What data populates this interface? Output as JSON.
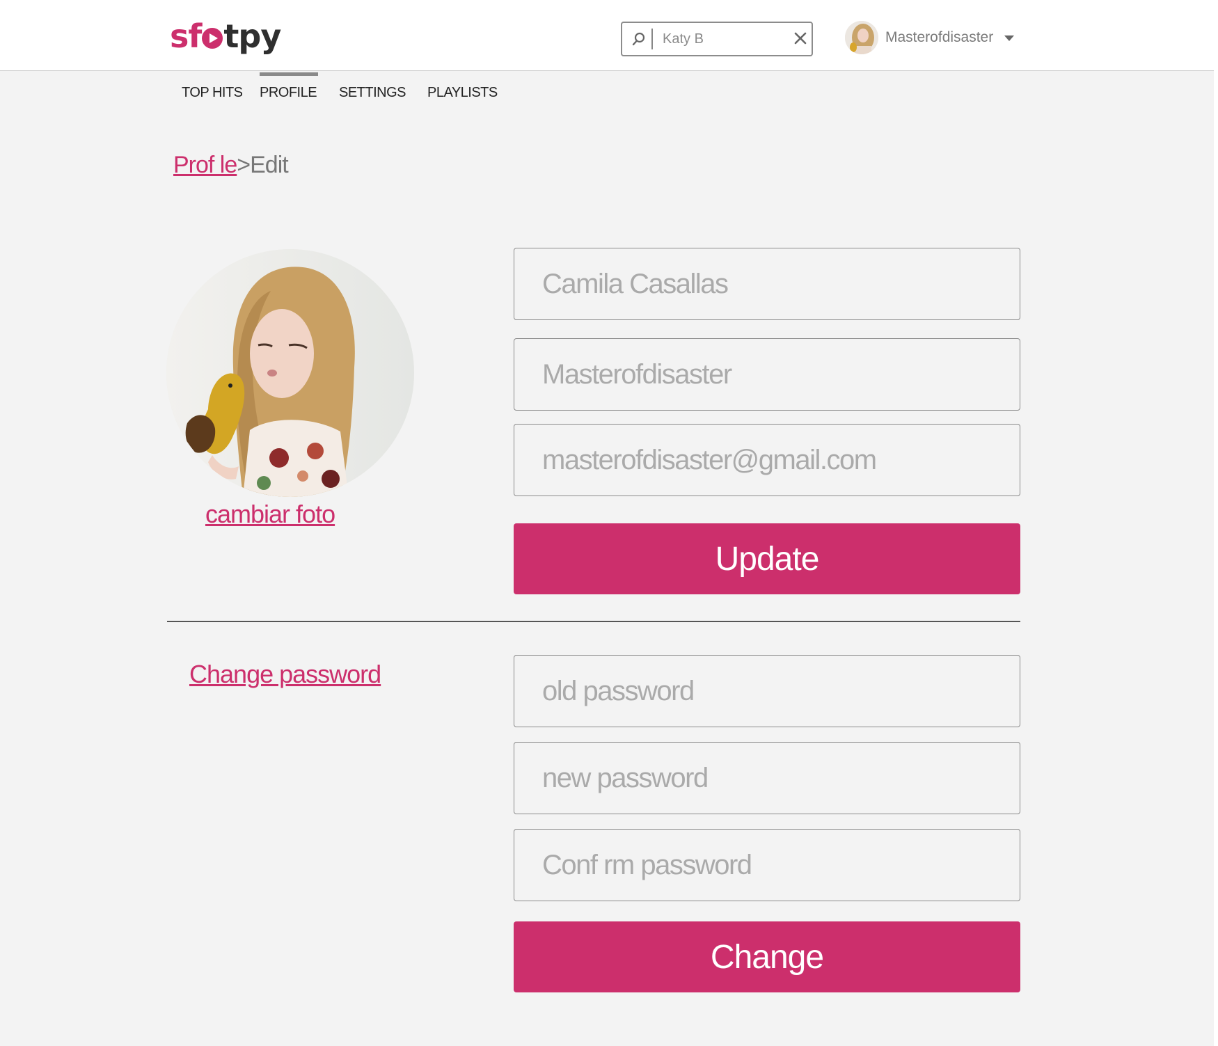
{
  "app": {
    "logo_parts": [
      "sf",
      "t",
      "py"
    ],
    "brand_color": "#cc2f6c"
  },
  "search": {
    "value": "Katy B",
    "icon": "search-icon",
    "clear_icon": "close-icon"
  },
  "user": {
    "name": "Masterofdisaster",
    "menu_icon": "caret-down-icon"
  },
  "tabs": [
    {
      "label": "TOP HITS"
    },
    {
      "label": "PROFILE",
      "active": true
    },
    {
      "label": "SETTINGS"
    },
    {
      "label": "PLAYLISTS"
    }
  ],
  "breadcrumb": {
    "parent": "Prof le",
    "separator": ">",
    "current": "Edit"
  },
  "profile": {
    "change_photo_label": "cambiar foto",
    "full_name": "Camila Casallas",
    "username": "Masterofdisaster",
    "email": "masterofdisaster@gmail.com",
    "update_label": "Update"
  },
  "password": {
    "section_label": "Change password",
    "old_placeholder": "old password",
    "new_placeholder": "new password",
    "confirm_placeholder": "Conf rm password",
    "change_label": "Change"
  }
}
